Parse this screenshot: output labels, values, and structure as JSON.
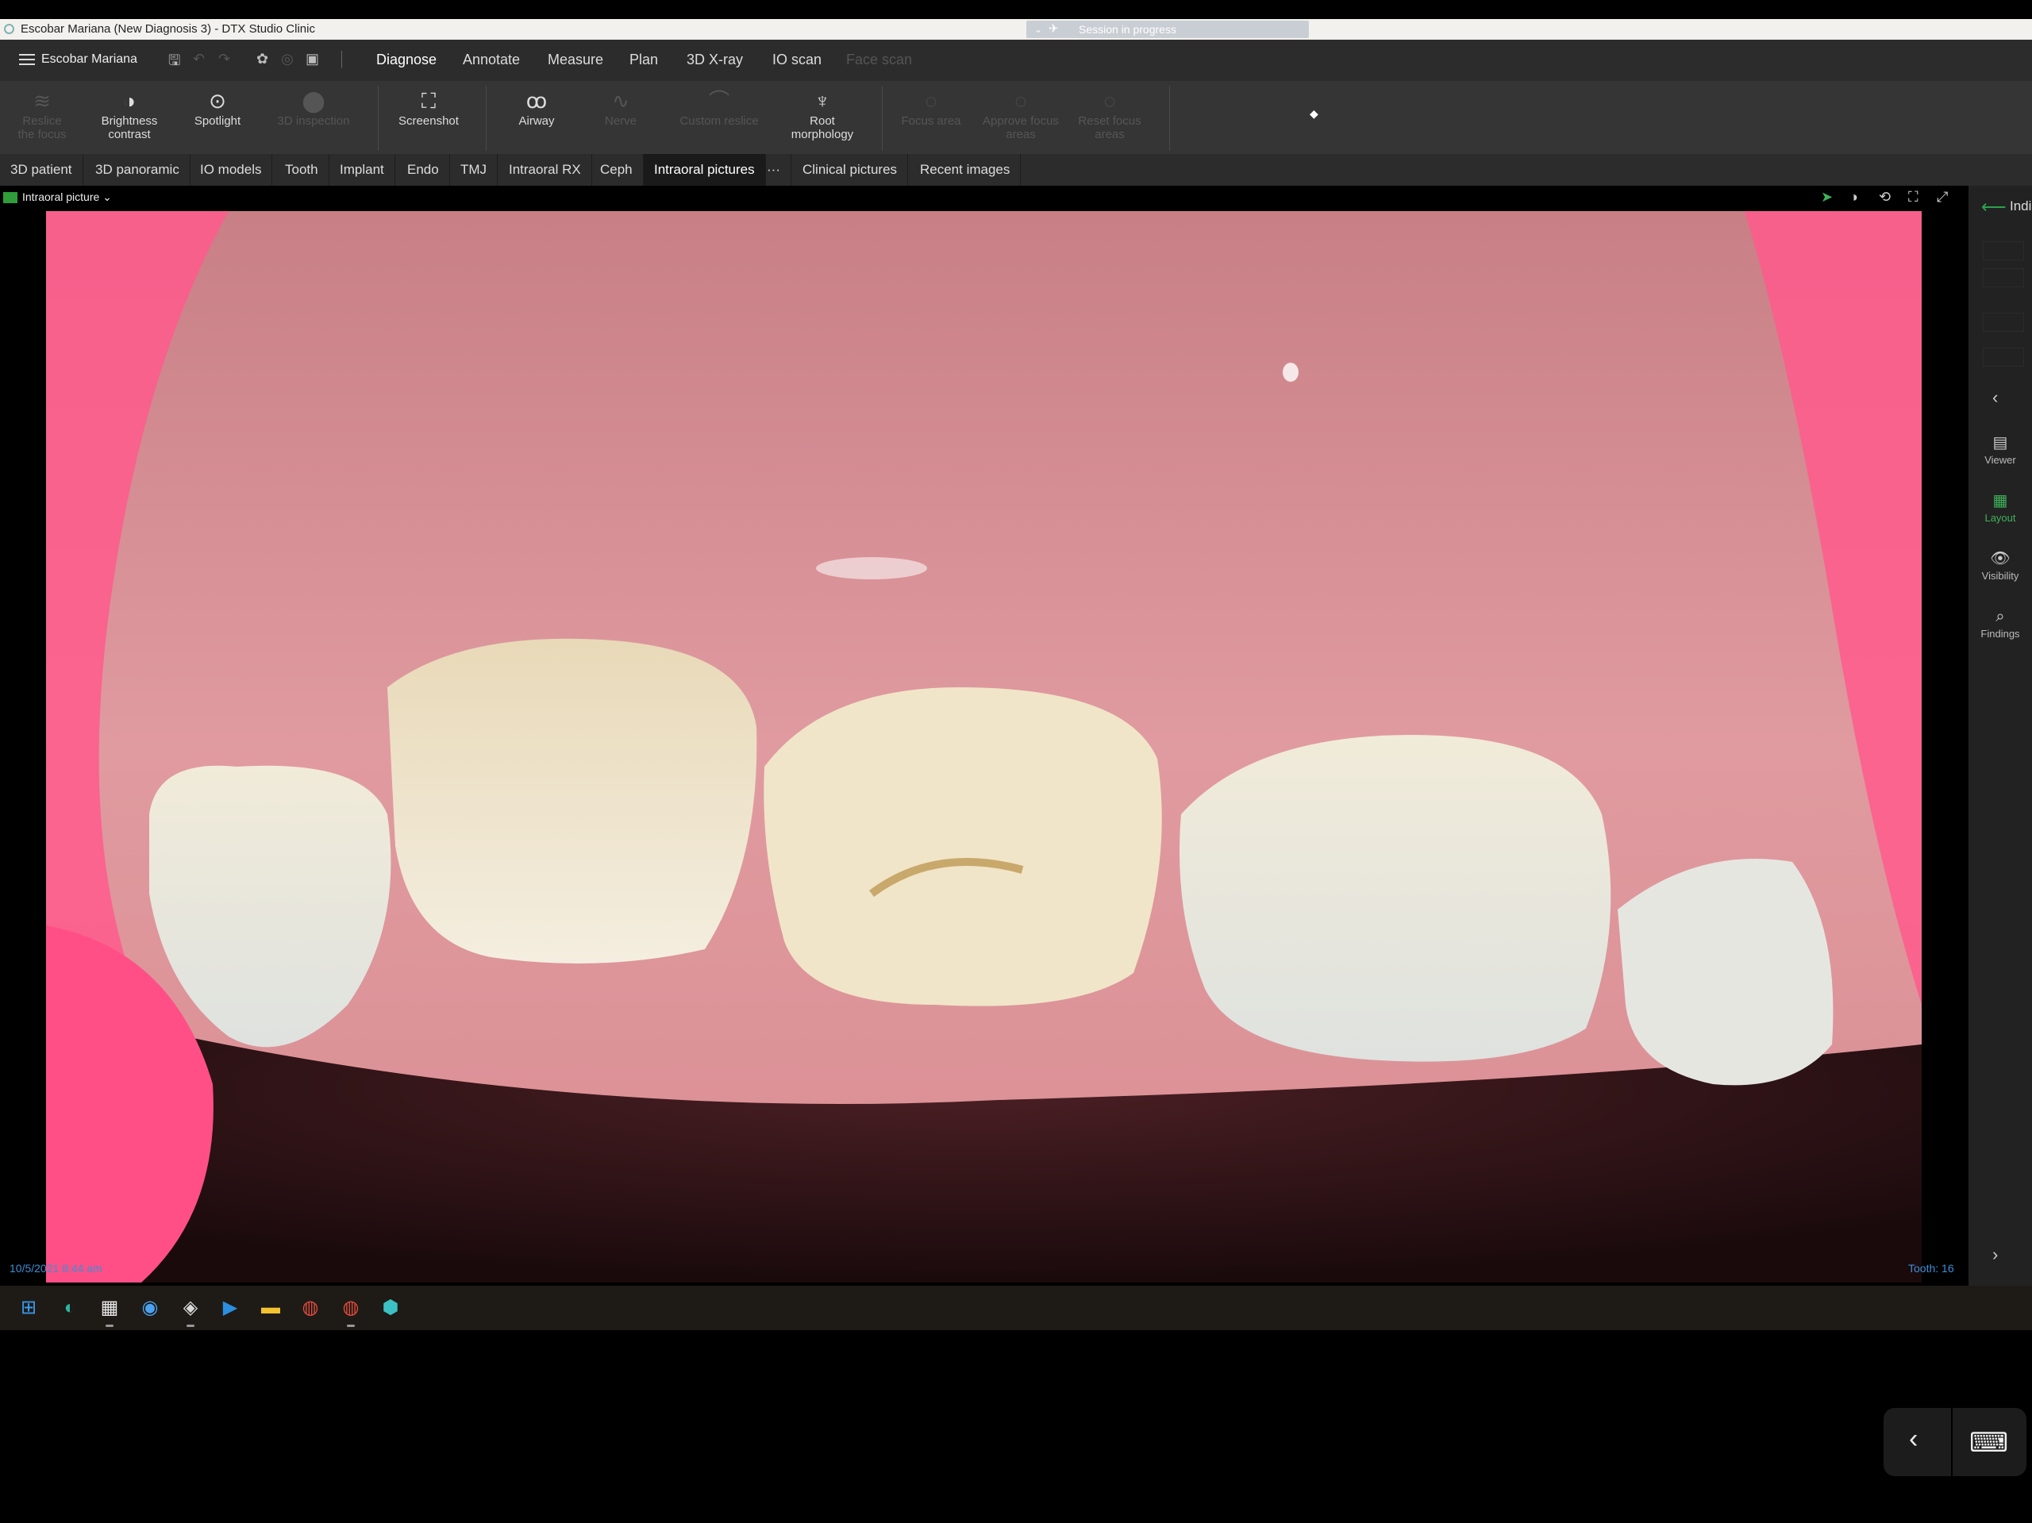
{
  "window": {
    "title": "Escobar Mariana (New Diagnosis 3) - DTX Studio Clinic",
    "session_text": "Session in progress"
  },
  "menubar": {
    "patient_name": "Escobar Mariana",
    "tabs": [
      {
        "label": "Diagnose"
      },
      {
        "label": "Annotate"
      },
      {
        "label": "Measure"
      },
      {
        "label": "Plan"
      },
      {
        "label": "3D X-ray"
      },
      {
        "label": "IO scan"
      },
      {
        "label": "Face scan"
      }
    ]
  },
  "toolbar": {
    "tools": [
      {
        "label": "Reslice the focus",
        "icon": "reslice-icon"
      },
      {
        "label": "Brightness contrast",
        "icon": "brightness-contrast-icon"
      },
      {
        "label": "Spotlight",
        "icon": "spotlight-icon"
      },
      {
        "label": "3D inspection",
        "icon": "3d-inspection-icon"
      },
      {
        "label": "Screenshot",
        "icon": "screenshot-icon"
      },
      {
        "label": "Airway",
        "icon": "airway-icon"
      },
      {
        "label": "Nerve",
        "icon": "nerve-icon"
      },
      {
        "label": "Custom reslice",
        "icon": "custom-reslice-icon"
      },
      {
        "label": "Root morphology",
        "icon": "root-morphology-icon"
      },
      {
        "label": "Focus area",
        "icon": "focus-area-icon"
      },
      {
        "label": "Approve focus areas",
        "icon": "approve-focus-icon"
      },
      {
        "label": "Reset focus areas",
        "icon": "reset-focus-icon"
      }
    ]
  },
  "image_tabs": [
    {
      "label": "3D patient"
    },
    {
      "label": "3D panoramic"
    },
    {
      "label": "IO models"
    },
    {
      "label": "Tooth"
    },
    {
      "label": "Implant"
    },
    {
      "label": "Endo"
    },
    {
      "label": "TMJ"
    },
    {
      "label": "Intraoral RX"
    },
    {
      "label": "Ceph"
    },
    {
      "label": "Intraoral pictures"
    },
    {
      "label": "···"
    },
    {
      "label": "Clinical pictures"
    },
    {
      "label": "Recent images"
    }
  ],
  "viewer": {
    "label": "Intraoral picture",
    "timestamp": "10/5/2021 8:44 am",
    "tooth": "Tooth: 16"
  },
  "right_panel": {
    "header": "Indi",
    "items": [
      {
        "label": "Viewer",
        "icon": "viewer-icon"
      },
      {
        "label": "Layout",
        "icon": "layout-icon"
      },
      {
        "label": "Visibility",
        "icon": "visibility-icon"
      },
      {
        "label": "Findings",
        "icon": "findings-icon"
      }
    ]
  },
  "colors": {
    "accent_green": "#2e9d3a",
    "timestamp_blue": "#3d8fd6",
    "toolbar_bg": "#353535",
    "menubar_bg": "#2c2c2c"
  }
}
